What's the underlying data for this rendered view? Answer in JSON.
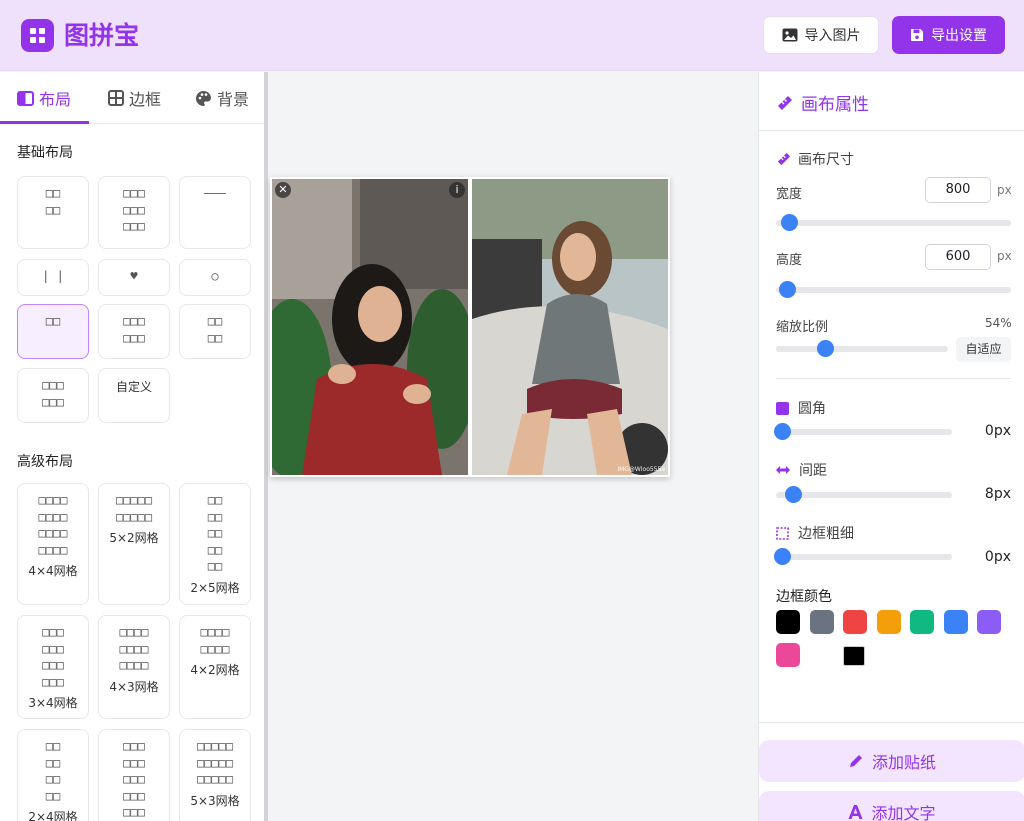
{
  "header": {
    "app_title": "图拼宝",
    "import_label": "导入图片",
    "export_label": "导出设置"
  },
  "left_panel": {
    "tabs": [
      {
        "label": "布局",
        "icon": "layout-columns-icon",
        "active": true
      },
      {
        "label": "边框",
        "icon": "grid-table-icon",
        "active": false
      },
      {
        "label": "背景",
        "icon": "palette-icon",
        "active": false
      }
    ],
    "basic_title": "基础布局",
    "basic_layouts": [
      {
        "glyph": "□□\n□□"
      },
      {
        "glyph": "□□□\n□□□\n□□□"
      },
      {
        "glyph": "———"
      },
      {
        "glyph": "| |"
      },
      {
        "glyph": "♥"
      },
      {
        "glyph": "○"
      },
      {
        "glyph": "□□",
        "selected": true
      },
      {
        "glyph": "□□□\n□□□"
      },
      {
        "glyph": "□□\n□□"
      },
      {
        "glyph": "□□□\n□□□"
      },
      {
        "glyph": "自定义"
      }
    ],
    "advanced_title": "高级布局",
    "advanced_layouts": [
      {
        "glyph": "□□□□\n□□□□\n□□□□\n□□□□",
        "label": "4×4网格"
      },
      {
        "glyph": "□□□□□\n□□□□□",
        "label": "5×2网格"
      },
      {
        "glyph": "□□\n□□\n□□\n□□\n□□",
        "label": "2×5网格"
      },
      {
        "glyph": "□□□\n□□□\n□□□\n□□□",
        "label": "3×4网格"
      },
      {
        "glyph": "□□□□\n□□□□\n□□□□",
        "label": "4×3网格"
      },
      {
        "glyph": "□□□□\n□□□□",
        "label": "4×2网格"
      },
      {
        "glyph": "□□\n□□\n□□\n□□",
        "label": "2×4网格"
      },
      {
        "glyph": "□□□\n□□□\n□□□\n□□□\n□□□",
        "label": ""
      },
      {
        "glyph": "□□□□□\n□□□□□\n□□□□□",
        "label": "5×3网格"
      }
    ]
  },
  "canvas": {
    "close_glyph": "✕",
    "info_glyph": "i",
    "watermark": "IMG@Wloo555a"
  },
  "right_panel": {
    "title": "画布属性",
    "size_section": "画布尺寸",
    "width_label": "宽度",
    "width_value": "800",
    "width_unit": "px",
    "width_slider": 0.03,
    "height_label": "高度",
    "height_value": "600",
    "height_unit": "px",
    "height_slider": 0.02,
    "zoom_label": "缩放比例",
    "zoom_value": "54%",
    "zoom_slider": 0.25,
    "fit_label": "自适应",
    "radius_label": "圆角",
    "radius_value": "0px",
    "radius_slider": 0,
    "spacing_label": "间距",
    "spacing_value": "8px",
    "spacing_slider": 0.06,
    "border_width_label": "边框粗细",
    "border_width_value": "0px",
    "border_width_slider": 0,
    "border_color_label": "边框颜色",
    "border_colors": [
      "#000000",
      "#6b7280",
      "#ef4444",
      "#f59e0b",
      "#10b981",
      "#3b82f6",
      "#8b5cf6",
      "#ec4899",
      "#000000"
    ],
    "add_sticker_label": "添加贴纸",
    "add_text_label": "添加文字",
    "accent_color": "#9333ea",
    "slider_color": "#3b82f6"
  }
}
